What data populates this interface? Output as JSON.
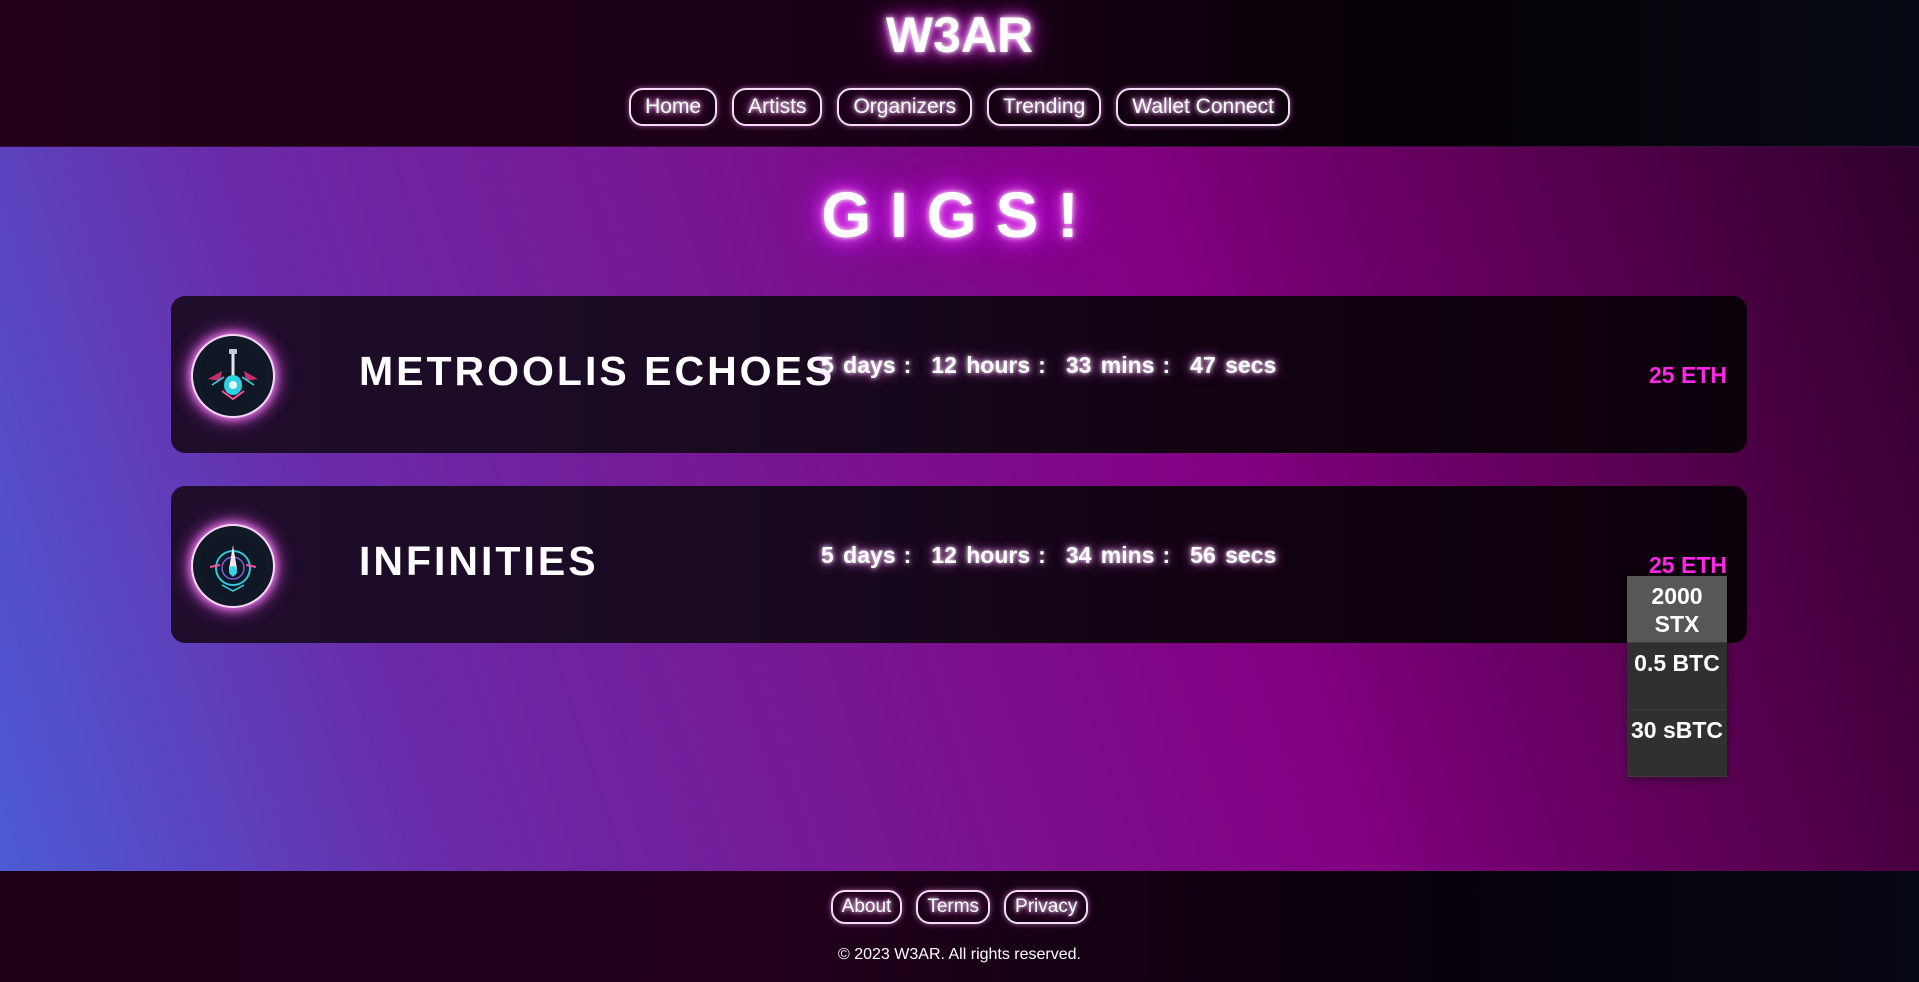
{
  "header": {
    "brand": "W3AR",
    "nav": [
      "Home",
      "Artists",
      "Organizers",
      "Trending",
      "Wallet Connect"
    ]
  },
  "main": {
    "title": "GIGS!",
    "gigs": [
      {
        "name": "METROOLIS ECHOES",
        "countdown": {
          "days": "5 days",
          "hours": "12 hours",
          "mins": "33 mins",
          "secs": "47 secs"
        },
        "price": "25 ETH"
      },
      {
        "name": "INFINITIES",
        "countdown": {
          "days": "5 days",
          "hours": "12 hours",
          "mins": "34 mins",
          "secs": "56 secs"
        },
        "price": "25 ETH"
      }
    ],
    "price_options": [
      "2000 STX",
      "0.5 BTC",
      "30 sBTC"
    ]
  },
  "footer": {
    "links": [
      "About",
      "Terms",
      "Privacy"
    ],
    "copyright": "© 2023 W3AR. All rights reserved."
  },
  "colors": {
    "accent_price": "#ff27e5",
    "glow": "#ff63ff"
  },
  "icons": [
    "guitar-emblem-icon",
    "compass-emblem-icon"
  ]
}
